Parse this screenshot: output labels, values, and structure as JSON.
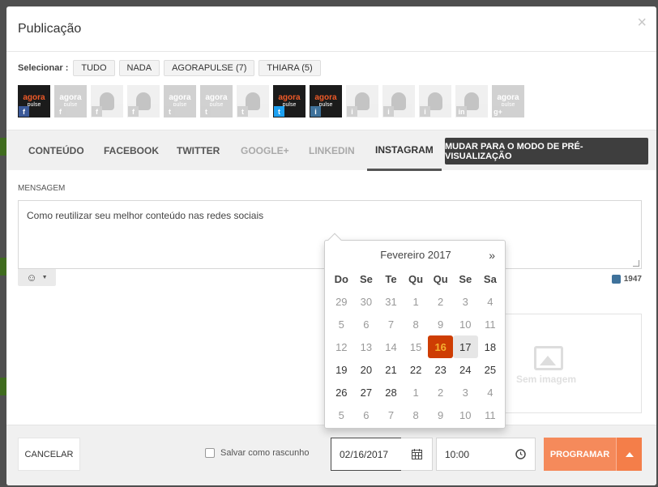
{
  "modal": {
    "title": "Publicação",
    "close": "×"
  },
  "select": {
    "label": "Selecionar :",
    "buttons": [
      "TUDO",
      "NADA",
      "AGORAPULSE (7)",
      "THIARA (5)"
    ]
  },
  "profiles": [
    {
      "kind": "agora",
      "network": "f",
      "badge": "nb-fb",
      "dim": false
    },
    {
      "kind": "agora-grey",
      "network": "f",
      "badge": "nb-grey",
      "dim": true
    },
    {
      "kind": "photo",
      "network": "f",
      "badge": "nb-grey",
      "dim": true
    },
    {
      "kind": "photo",
      "network": "f",
      "badge": "nb-grey",
      "dim": true
    },
    {
      "kind": "agora-grey",
      "network": "t",
      "badge": "nb-grey",
      "dim": true
    },
    {
      "kind": "agora-grey",
      "network": "t",
      "badge": "nb-grey",
      "dim": true
    },
    {
      "kind": "photo",
      "network": "t",
      "badge": "nb-grey",
      "dim": true
    },
    {
      "kind": "agora",
      "network": "t",
      "badge": "nb-tw",
      "dim": false
    },
    {
      "kind": "agora",
      "network": "i",
      "badge": "nb-ig",
      "dim": false
    },
    {
      "kind": "photo",
      "network": "i",
      "badge": "nb-grey",
      "dim": true
    },
    {
      "kind": "photo",
      "network": "i",
      "badge": "nb-grey",
      "dim": true
    },
    {
      "kind": "photo",
      "network": "i",
      "badge": "nb-grey",
      "dim": true
    },
    {
      "kind": "photo",
      "network": "in",
      "badge": "nb-grey",
      "dim": true
    },
    {
      "kind": "agora-grey",
      "network": "g+",
      "badge": "nb-grey",
      "dim": true
    }
  ],
  "profile_logo": {
    "line1": "agora",
    "line2": "pulse"
  },
  "tabs": [
    {
      "label": "CONTEÚDO",
      "state": "normal"
    },
    {
      "label": "FACEBOOK",
      "state": "normal"
    },
    {
      "label": "TWITTER",
      "state": "normal"
    },
    {
      "label": "GOOGLE+",
      "state": "disabled"
    },
    {
      "label": "LINKEDIN",
      "state": "disabled"
    },
    {
      "label": "INSTAGRAM",
      "state": "active"
    }
  ],
  "preview_button": "MUDAR PARA O MODO DE PRÉ-VISUALIZAÇÃO",
  "message": {
    "label": "MENSAGEM",
    "text": "Como reutilizar seu melhor conteúdo nas redes sociais",
    "char_count": "1947"
  },
  "image_placeholder": "Sem imagem",
  "footer": {
    "cancel": "CANCELAR",
    "draft_label": "Salvar como rascunho",
    "date_value": "02/16/2017",
    "time_value": "10:00",
    "program": "PROGRAMAR"
  },
  "datepicker": {
    "title": "Fevereiro 2017",
    "next": "»",
    "weekdays": [
      "Do",
      "Se",
      "Te",
      "Qu",
      "Qu",
      "Se",
      "Sa"
    ],
    "weeks": [
      [
        [
          "29",
          "old"
        ],
        [
          "30",
          "old"
        ],
        [
          "31",
          "old"
        ],
        [
          "1",
          "old"
        ],
        [
          "2",
          "old"
        ],
        [
          "3",
          "old"
        ],
        [
          "4",
          "old"
        ]
      ],
      [
        [
          "5",
          "old"
        ],
        [
          "6",
          "old"
        ],
        [
          "7",
          "old"
        ],
        [
          "8",
          "old"
        ],
        [
          "9",
          "old"
        ],
        [
          "10",
          "old"
        ],
        [
          "11",
          "old"
        ]
      ],
      [
        [
          "12",
          "old"
        ],
        [
          "13",
          "old"
        ],
        [
          "14",
          "old"
        ],
        [
          "15",
          "old"
        ],
        [
          "16",
          "active"
        ],
        [
          "17",
          "today"
        ],
        [
          "18",
          ""
        ]
      ],
      [
        [
          "19",
          ""
        ],
        [
          "20",
          ""
        ],
        [
          "21",
          ""
        ],
        [
          "22",
          ""
        ],
        [
          "23",
          ""
        ],
        [
          "24",
          ""
        ],
        [
          "25",
          ""
        ]
      ],
      [
        [
          "26",
          ""
        ],
        [
          "27",
          ""
        ],
        [
          "28",
          ""
        ],
        [
          "1",
          "old"
        ],
        [
          "2",
          "old"
        ],
        [
          "3",
          "old"
        ],
        [
          "4",
          "old"
        ]
      ],
      [
        [
          "5",
          "old"
        ],
        [
          "6",
          "old"
        ],
        [
          "7",
          "old"
        ],
        [
          "8",
          "old"
        ],
        [
          "9",
          "old"
        ],
        [
          "10",
          "old"
        ],
        [
          "11",
          "old"
        ]
      ]
    ]
  },
  "colors": {
    "accent": "#f58a5b",
    "active_day": "#ce3d03",
    "active_day_text": "#f4b030"
  }
}
